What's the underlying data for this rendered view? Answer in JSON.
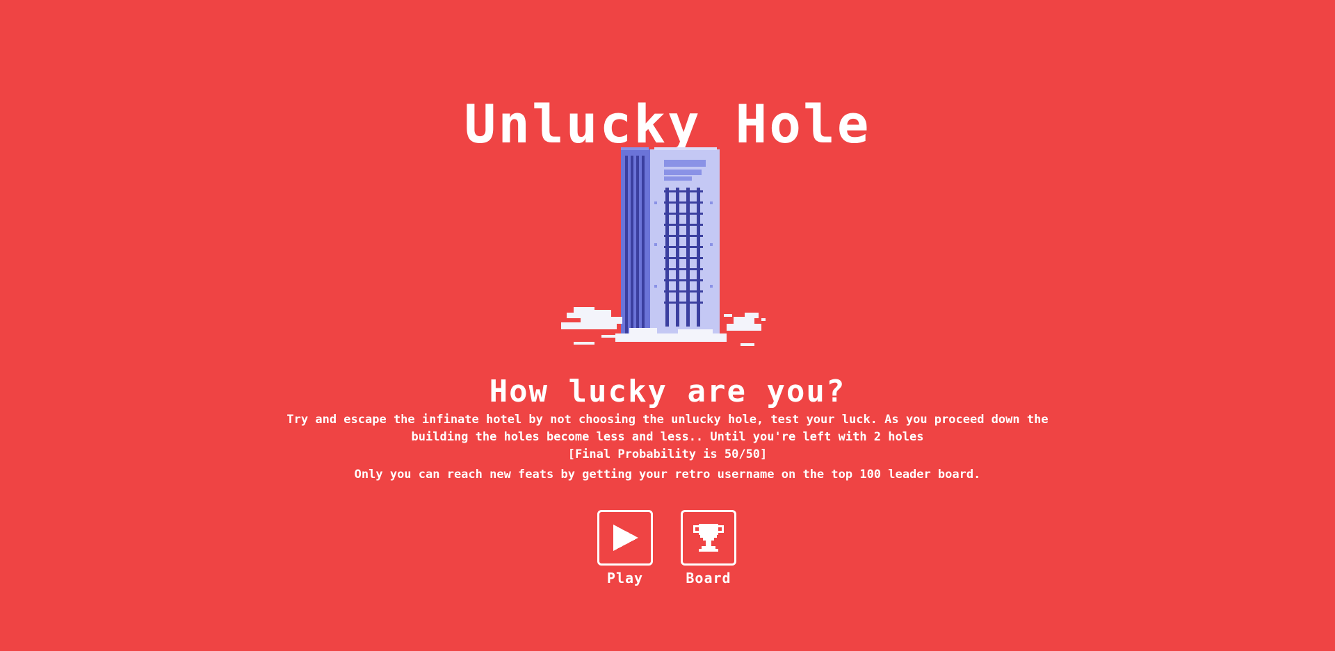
{
  "header": {
    "title": "Unlucky Hole"
  },
  "hero": {
    "icon": "pixel-hotel-building-icon"
  },
  "intro": {
    "subtitle": "How lucky are you?",
    "description": "Try and escape the infinate hotel by not choosing the unlucky hole, test your luck. As you proceed down the building the holes become less and less.. Until you're left with 2 holes",
    "probability": "[Final Probability is 50/50]",
    "leaderboard_note": "Only you can reach new feats by getting your retro username on the top 100 leader board."
  },
  "actions": {
    "play": {
      "label": "Play",
      "icon": "play-icon"
    },
    "board": {
      "label": "Board",
      "icon": "trophy-icon"
    }
  },
  "colors": {
    "background": "#ef4444",
    "text": "#ffffff",
    "building_dark": "#6b74d8",
    "building_light": "#c4c8f4",
    "building_window": "#3b3f9f",
    "cloud": "#f3f4fb"
  }
}
